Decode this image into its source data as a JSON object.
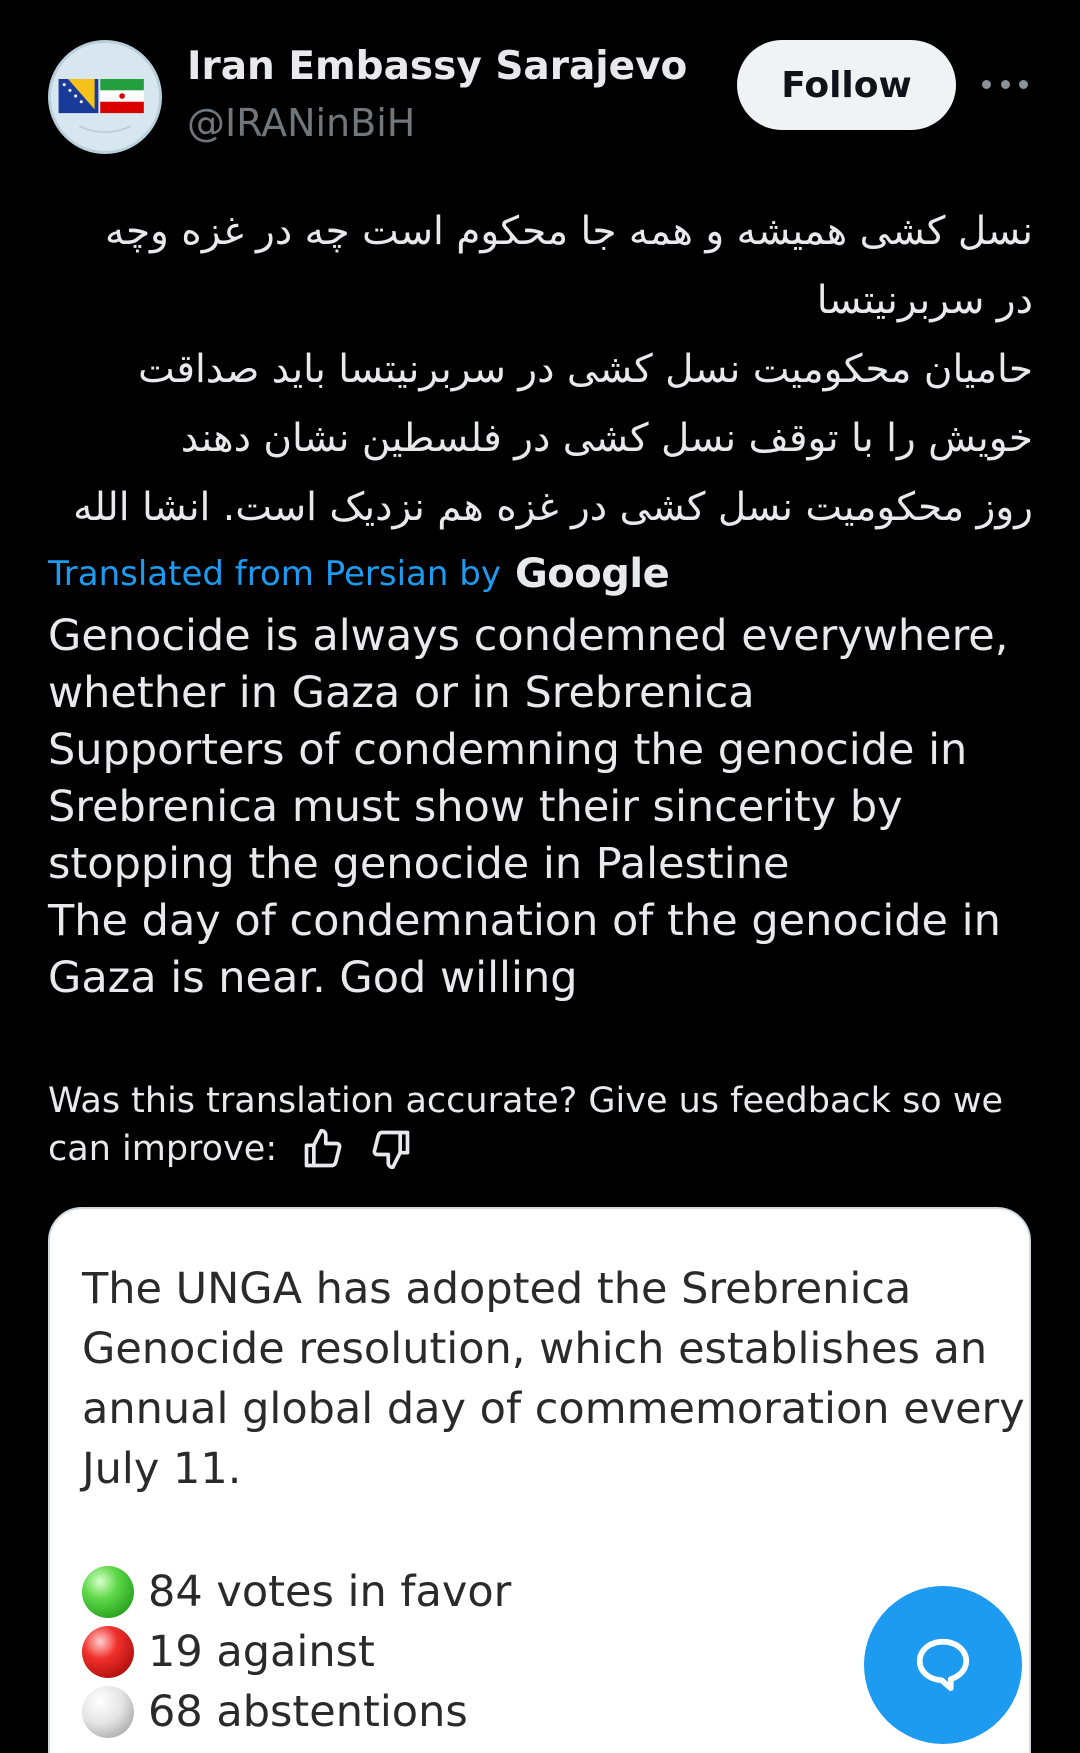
{
  "header": {
    "display_name": "Iran Embassy Sarajevo",
    "handle": "@IRANinBiH",
    "follow_label": "Follow"
  },
  "post": {
    "persian_lines": [
      "نسل کشی همیشه و همه جا محکوم است چه در غزه وچه",
      "در سربرنیتسا",
      "حامیان محکومیت نسل کشی در سربرنیتسا  باید صداقت",
      "خویش را با توقف نسل کشی در فلسطین نشان دهند",
      "روز محکومیت نسل کشی در غزه هم نزدیک است. انشا الله"
    ],
    "translated_from": "Translated from Persian by",
    "translator_brand": "Google",
    "translation_lines": [
      "Genocide is always condemned everywhere,",
      "whether in Gaza or in Srebrenica",
      "Supporters of condemning the genocide in",
      "Srebrenica must show their sincerity by",
      "stopping the genocide in Palestine",
      "The day of condemnation of the genocide in",
      "Gaza is near. God willing"
    ],
    "feedback_line1": "Was this translation accurate? Give us feedback so we",
    "feedback_line2": "can improve:"
  },
  "quoted_card": {
    "text_lines": [
      "The UNGA has adopted the Srebrenica",
      "Genocide resolution, which establishes an",
      "annual global day of commemoration every",
      "July 11."
    ],
    "votes": [
      {
        "label": "84 votes in favor",
        "color": "green"
      },
      {
        "label": "19 against",
        "color": "red"
      },
      {
        "label": "68 abstentions",
        "color": "white"
      }
    ]
  },
  "icons": {
    "more": "more-horizontal-icon",
    "thumbs_up": "thumbs-up-icon",
    "thumbs_down": "thumbs-down-icon",
    "compose": "compose-reply-icon"
  },
  "colors": {
    "background": "#000000",
    "text": "#e7e9ea",
    "muted": "#71767b",
    "accent": "#1d9bf0",
    "follow_bg": "#eff3f4"
  }
}
